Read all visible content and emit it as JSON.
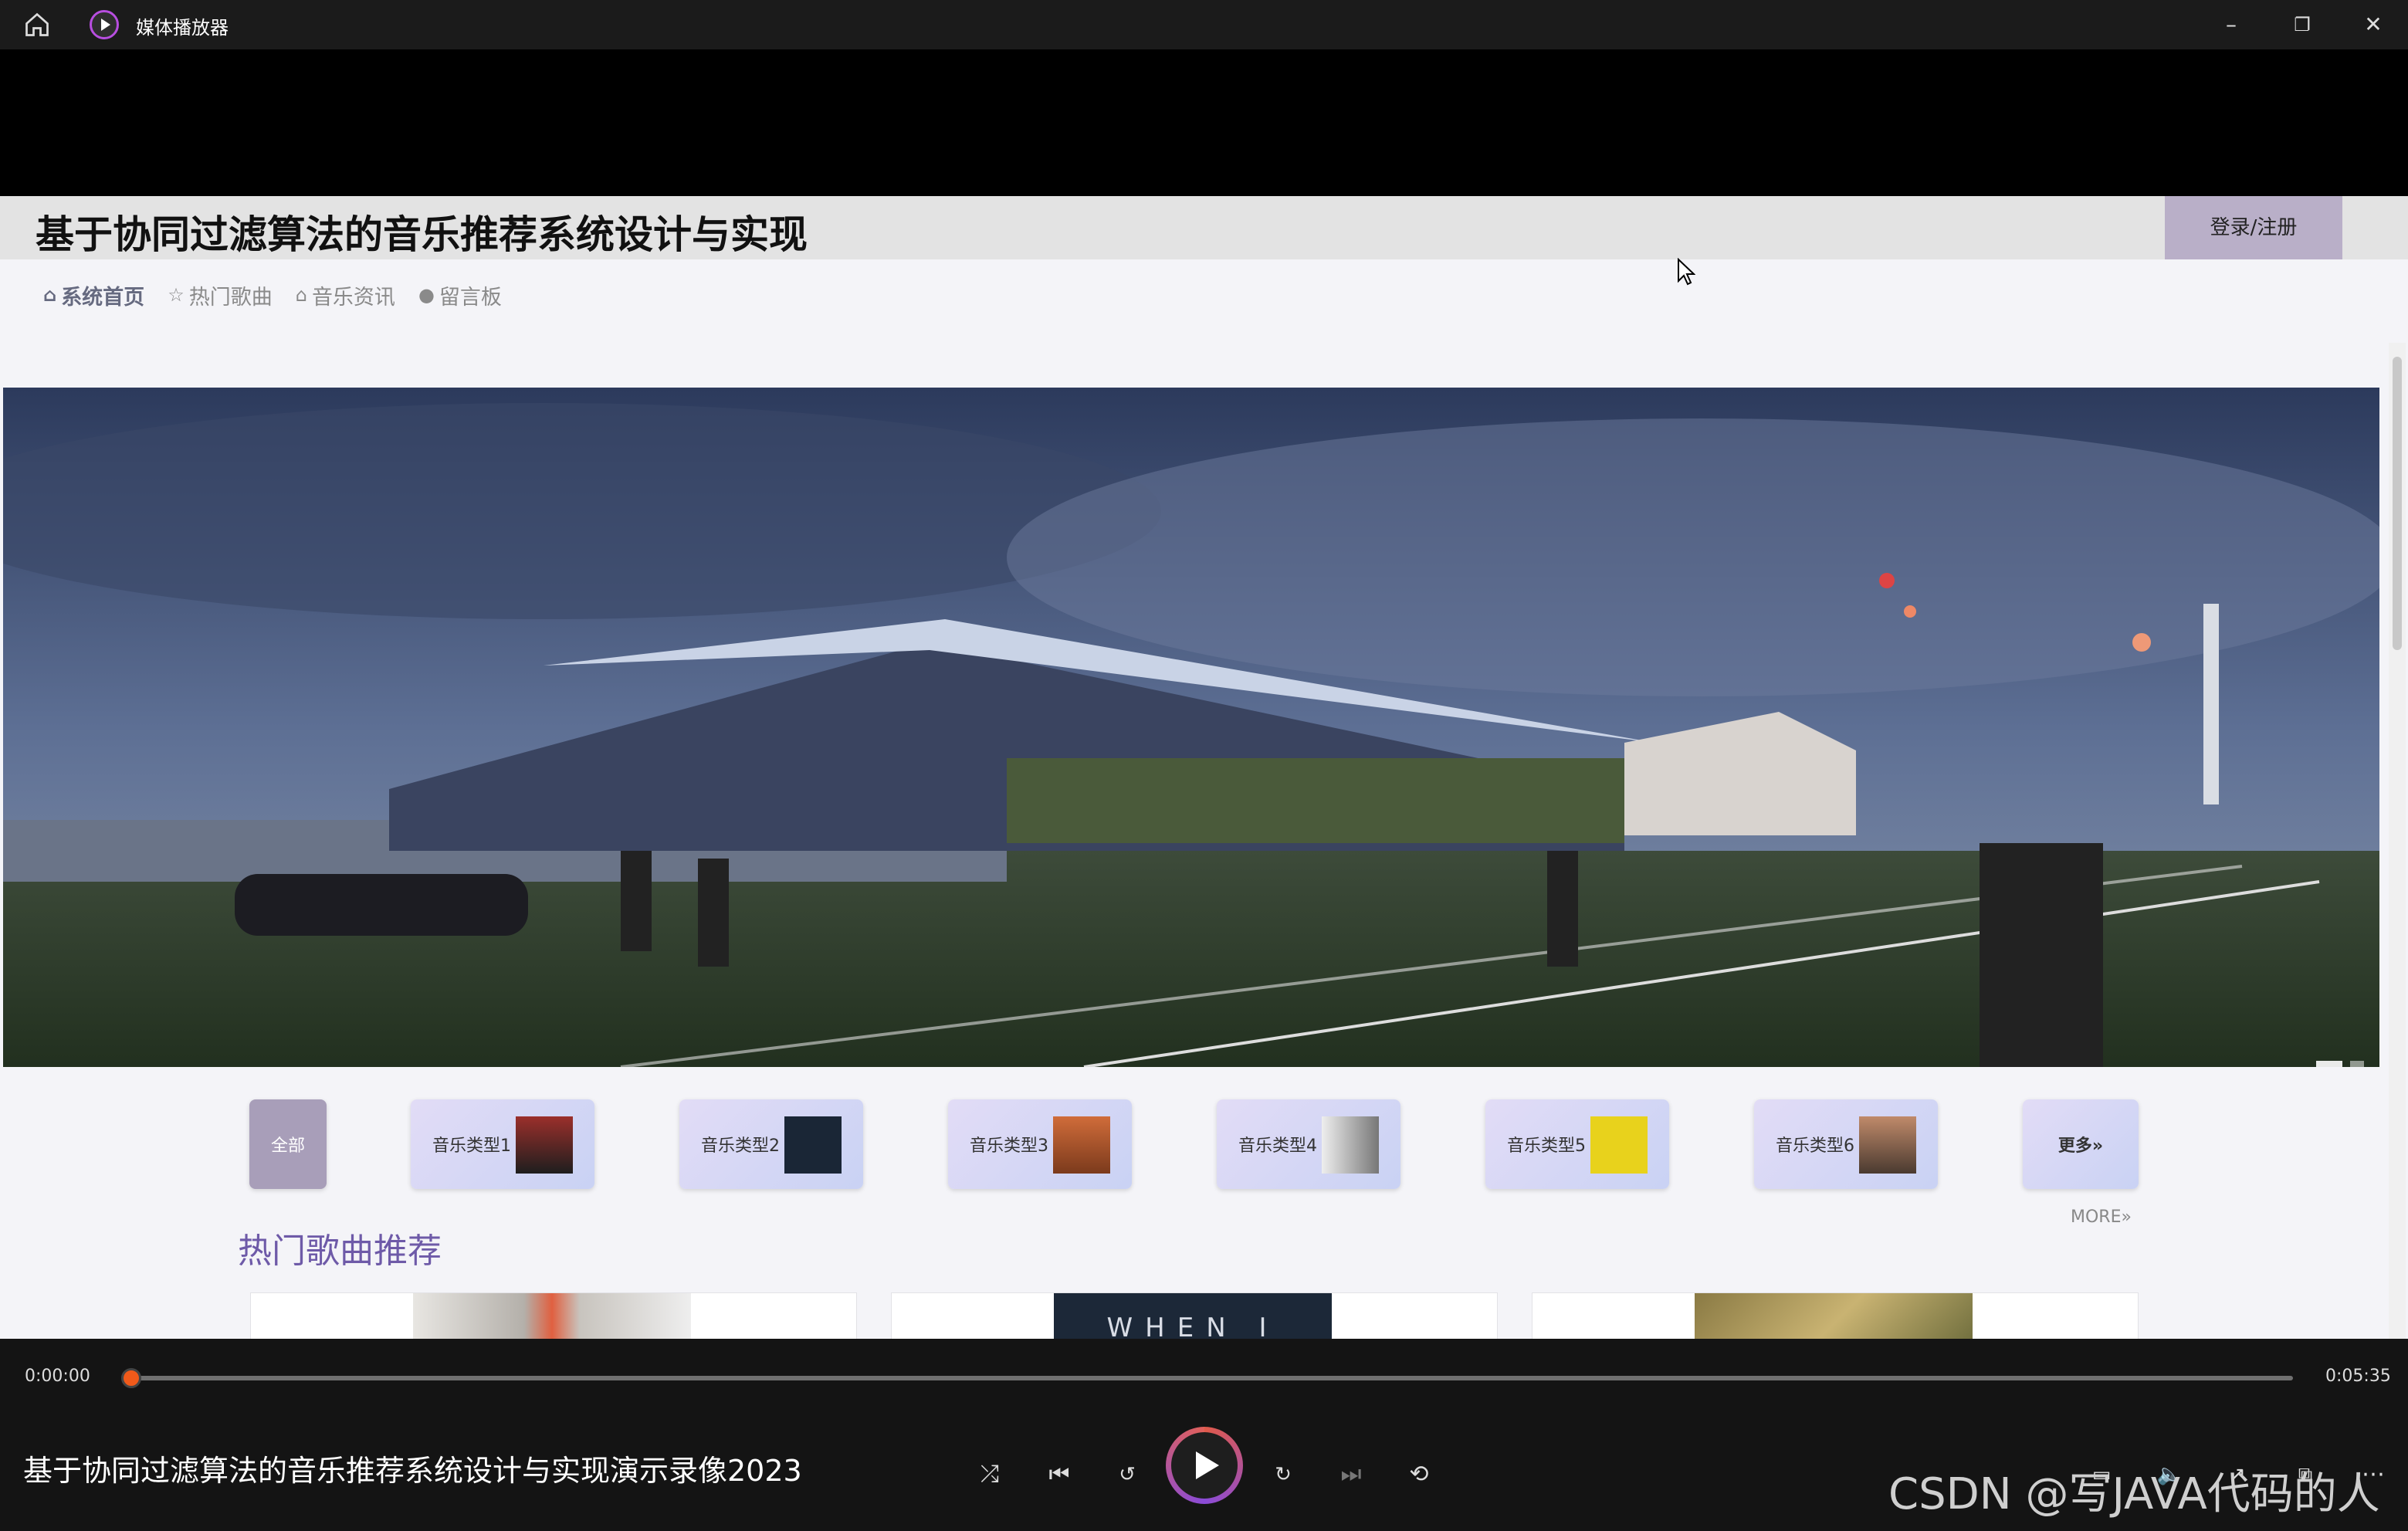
{
  "app": {
    "title": "媒体播放器"
  },
  "web": {
    "site_title": "基于协同过滤算法的音乐推荐系统设计与实现",
    "login_label": "登录/注册",
    "nav": [
      {
        "icon": "home-icon",
        "label": "系统首页"
      },
      {
        "icon": "star-icon",
        "label": "热门歌曲"
      },
      {
        "icon": "bag-icon",
        "label": "音乐资讯"
      },
      {
        "icon": "alert-icon",
        "label": "留言板"
      }
    ],
    "categories": [
      {
        "label": "全部"
      },
      {
        "label": "音乐类型1"
      },
      {
        "label": "音乐类型2"
      },
      {
        "label": "音乐类型3"
      },
      {
        "label": "音乐类型4"
      },
      {
        "label": "音乐类型5"
      },
      {
        "label": "音乐类型6"
      },
      {
        "label": "更多»"
      }
    ],
    "hot_title": "热门歌曲推荐",
    "more_label": "MORE»",
    "cards": [
      {
        "art_text": ""
      },
      {
        "art_text": "WHEN I"
      },
      {
        "art_text": ""
      }
    ]
  },
  "player": {
    "time_current": "0:00:00",
    "time_total": "0:05:35",
    "progress": 0.0,
    "media_title": "基于协同过滤算法的音乐推荐系统设计与实现演示录像2023",
    "watermark": "CSDN @写JAVA代码的人"
  },
  "colors": {
    "accent": "#6e5aa8",
    "seek": "#f05a1a",
    "login_bg": "#b9afc8"
  }
}
